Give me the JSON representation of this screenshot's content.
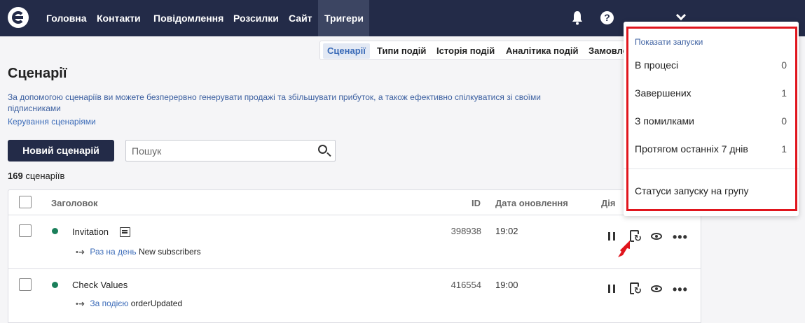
{
  "nav": {
    "items": [
      "Головна",
      "Контакти",
      "Повідомлення",
      "Розсилки",
      "Сайт",
      "Тригери"
    ],
    "active": "Тригери",
    "icons": [
      "logo-icon",
      "bell-icon",
      "help-icon",
      "chevron-down-icon"
    ],
    "help_glyph": "?",
    "colors": {
      "background": "#232b48",
      "active": "#3c4562"
    }
  },
  "subnav": {
    "items": [
      "Сценарії",
      "Типи подій",
      "Історія подій",
      "Аналітика подій",
      "Замовле"
    ],
    "active": "Сценарії"
  },
  "page": {
    "title": "Сценарії",
    "description": "За допомогою сценаріїв ви можете безперервно генерувати продажі та збільшувати прибуток, а також ефективно спілкуватися зі своїми підписниками",
    "link": "Керування сценаріями",
    "new_button": "Новий сценарій",
    "search_placeholder": "Пошук",
    "count_number": "169",
    "count_label": "сценаріїв"
  },
  "table": {
    "columns": {
      "title": "Заголовок",
      "id": "ID",
      "date": "Дата оновлення",
      "action": "Дія"
    },
    "rows": [
      {
        "title": "Invitation",
        "trigger_type": "Раз на день",
        "trigger_value": "New subscribers",
        "id": "398938",
        "date": "19:02",
        "status_color": "#1a7f5a"
      },
      {
        "title": "Check Values",
        "trigger_type": "За подією",
        "trigger_value": "orderUpdated",
        "id": "416554",
        "date": "19:00",
        "status_color": "#1a7f5a"
      }
    ],
    "more_glyph": "•••",
    "arrow_glyph": "•➜"
  },
  "dropdown": {
    "header": "Показати запуски",
    "items": [
      {
        "label": "В процесі",
        "count": "0"
      },
      {
        "label": "Завершених",
        "count": "1"
      },
      {
        "label": "З помилками",
        "count": "0"
      },
      {
        "label": "Протягом останніх 7 днів",
        "count": "1"
      }
    ],
    "footer_item": "Статуси запуску на групу",
    "highlight_color": "#e0151d"
  }
}
